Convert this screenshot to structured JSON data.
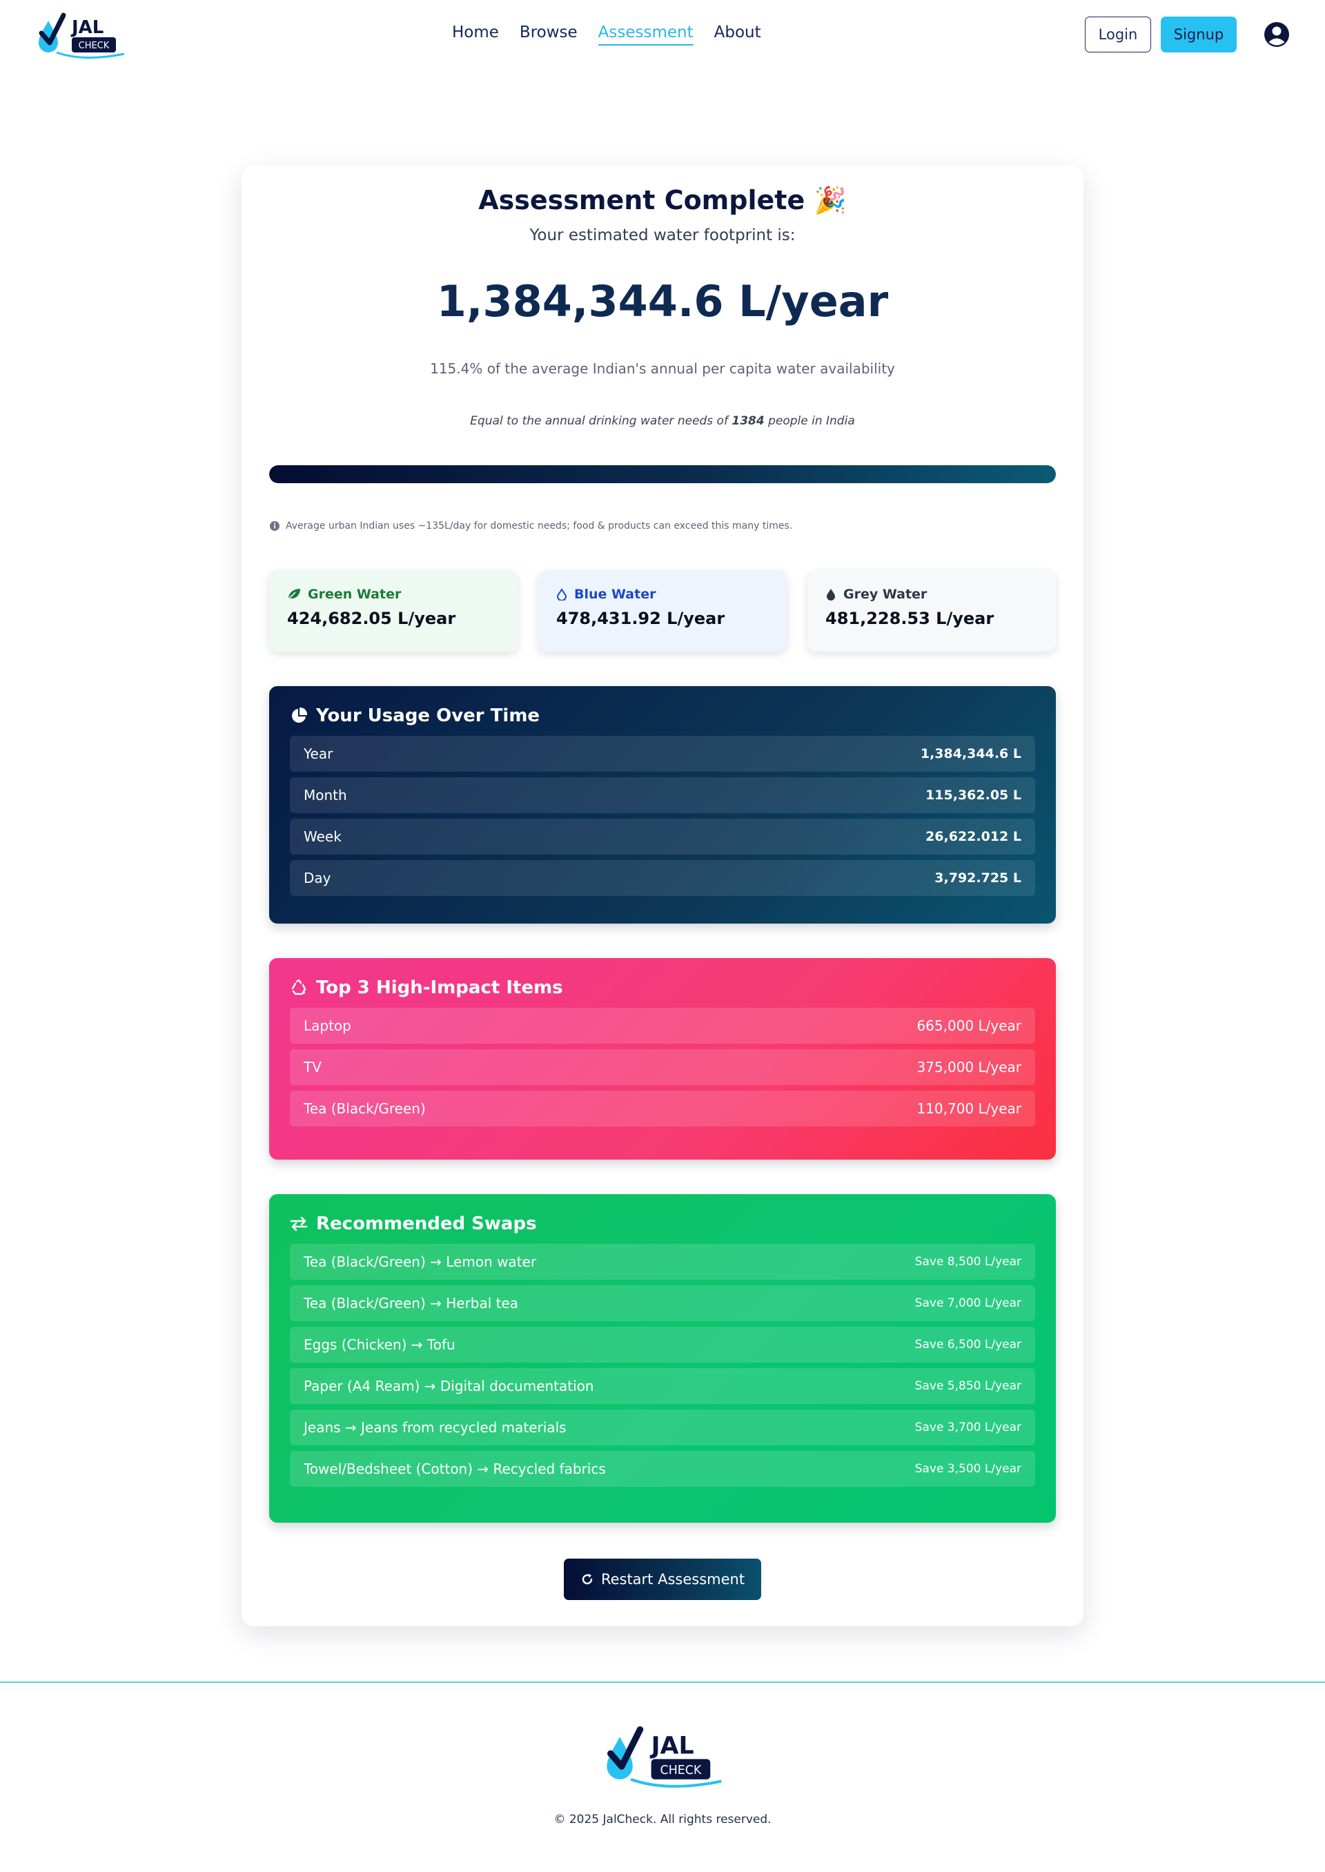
{
  "nav": {
    "logo": {
      "word1": "JAL",
      "word2": "CHECK"
    },
    "links": [
      "Home",
      "Browse",
      "Assessment",
      "About"
    ],
    "active": "Assessment",
    "login_label": "Login",
    "signup_label": "Signup",
    "icons": {
      "avatar": "user-circle-icon"
    }
  },
  "result": {
    "title": "Assessment Complete",
    "title_emoji": "🎉",
    "subtitle": "Your estimated water footprint is:",
    "value": "1,384,344.6 L/year",
    "percent_text": "115.4% of the average Indian's annual per capita water availability",
    "people_prefix": "Equal to the annual drinking water needs of ",
    "people_count": "1384",
    "people_suffix": " people in India",
    "progress_fraction": 1.0,
    "info_text": "Average urban Indian uses ~135L/day for domestic needs; food & products can exceed this many times."
  },
  "water_types": [
    {
      "label": "Green Water",
      "value": "424,682.05 L/year",
      "icon": "leaf-icon",
      "color": "#1c7a3c"
    },
    {
      "label": "Blue Water",
      "value": "478,431.92 L/year",
      "icon": "droplet-outline-icon",
      "color": "#1b49c4"
    },
    {
      "label": "Grey Water",
      "value": "481,228.53 L/year",
      "icon": "droplet-icon",
      "color": "#2f3646"
    }
  ],
  "usage": {
    "title": "Your Usage Over Time",
    "icon": "pie-chart-icon",
    "rows": [
      {
        "label": "Year",
        "value": "1,384,344.6 L"
      },
      {
        "label": "Month",
        "value": "115,362.05 L"
      },
      {
        "label": "Week",
        "value": "26,622.012 L"
      },
      {
        "label": "Day",
        "value": "3,792.725 L"
      }
    ]
  },
  "impact": {
    "title": "Top 3 High-Impact Items",
    "icon": "recycle-icon",
    "rows": [
      {
        "label": "Laptop",
        "value": "665,000 L/year"
      },
      {
        "label": "TV",
        "value": "375,000 L/year"
      },
      {
        "label": "Tea (Black/Green)",
        "value": "110,700 L/year"
      }
    ]
  },
  "swaps": {
    "title": "Recommended Swaps",
    "icon": "swap-arrows-icon",
    "rows": [
      {
        "label": "Tea (Black/Green) → Lemon water",
        "value": "Save 8,500 L/year"
      },
      {
        "label": "Tea (Black/Green) → Herbal tea",
        "value": "Save 7,000 L/year"
      },
      {
        "label": "Eggs (Chicken) → Tofu",
        "value": "Save 6,500 L/year"
      },
      {
        "label": "Paper (A4 Ream) → Digital documentation",
        "value": "Save 5,850 L/year"
      },
      {
        "label": "Jeans → Jeans from recycled materials",
        "value": "Save 3,700 L/year"
      },
      {
        "label": "Towel/Bedsheet (Cotton) → Recycled fabrics",
        "value": "Save 3,500 L/year"
      }
    ]
  },
  "restart_label": "Restart Assessment",
  "footer": {
    "copyright": "© 2025 JalCheck. All rights reserved."
  },
  "colors": {
    "accent": "#27c1f1",
    "navy": "#0b1640"
  }
}
